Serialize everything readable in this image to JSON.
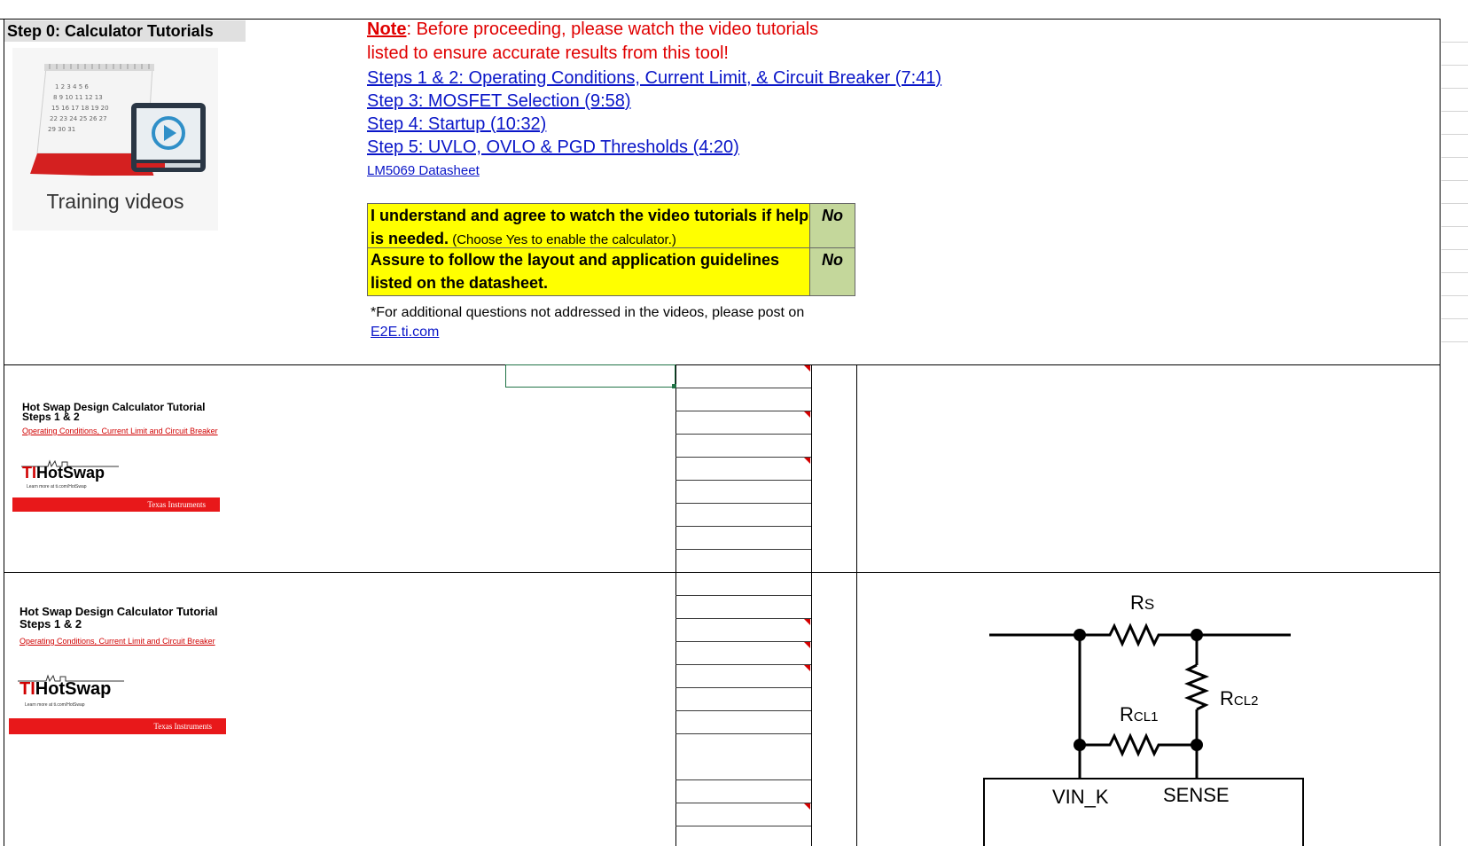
{
  "step_header": "Step 0: Calculator Tutorials",
  "training": {
    "caption": "Training videos",
    "icon": "calendar-video-icon"
  },
  "note": {
    "label": "Note",
    "line1_rest": ": Before proceeding, please watch the video tutorials",
    "line2": "listed to ensure accurate results from this tool!"
  },
  "links": [
    "Steps 1 & 2: Operating Conditions, Current Limit, & Circuit Breaker (7:41)",
    "Step 3: MOSFET Selection (9:58)",
    "Step 4: Startup (10:32)",
    "Step 5: UVLO, OVLO & PGD Thresholds (4:20)",
    "LM5069 Datasheet"
  ],
  "agreements": [
    {
      "text_bold": "I understand and agree to watch the video tutorials if help is needed.",
      "text_small": " (Choose Yes to enable the calculator.)",
      "value": "No"
    },
    {
      "text_bold": "Assure to follow the layout and application guidelines listed on the datasheet.",
      "value": "No"
    }
  ],
  "footer_note": {
    "text": "*For additional questions not addressed in the videos, please post on",
    "link": " E2E.ti.com"
  },
  "thumbnails": [
    {
      "title": "Hot Swap Design Calculator Tutorial",
      "steps": "Steps 1 & 2",
      "subtitle": "Operating Conditions, Current Limit and Circuit Breaker",
      "brand_ti": "TI",
      "brand_rest": "HotSwap",
      "tagline": "Learn more at ti.com/HotSwap",
      "bar_text": "Texas Instruments"
    },
    {
      "title": "Hot Swap Design Calculator Tutorial",
      "steps": "Steps 1 & 2",
      "subtitle": "Operating Conditions, Current Limit and Circuit Breaker",
      "brand_ti": "TI",
      "brand_rest": "HotSwap",
      "tagline": "Learn more at ti.com/HotSwap",
      "bar_text": "Texas Instruments"
    }
  ],
  "circuit": {
    "rs_main": "R",
    "rs_sub": "S",
    "rcl1_main": "R",
    "rcl1_sub": "CL1",
    "rcl2_main": "R",
    "rcl2_sub": "CL2",
    "pin_left": "VIN_K",
    "pin_right": "SENSE"
  },
  "colors": {
    "note_red": "#e00000",
    "link_blue": "#0a16c8",
    "yellow": "#ffff00",
    "green": "#c4d79b",
    "ti_red": "#e8181a"
  }
}
